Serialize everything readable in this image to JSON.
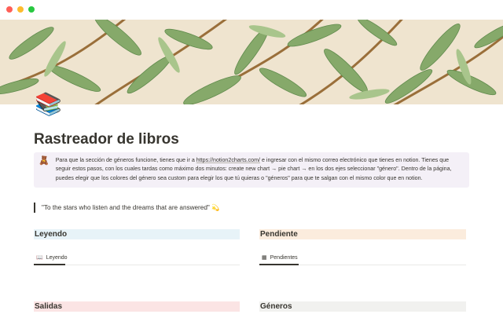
{
  "window": {
    "controls": [
      "close",
      "minimize",
      "maximize"
    ]
  },
  "cover": {
    "description_icon": "leaf-pattern-cover"
  },
  "page": {
    "icon": "📚",
    "title": "Rastreador de libros"
  },
  "callout": {
    "icon": "🧸",
    "text_before_link": "Para que la sección de géneros funcione, tienes que ir a ",
    "link": "https://notion2charts.com/",
    "text_after_link": " e ingresar con el mismo correo electrónico que tienes en notion. Tienes que seguir estos pasos, con los cuales tardas como máximo dos minutos: create new chart → pie chart → en los dos ejes seleccionar \"género\". Dentro de la página, puedes elegir que los colores del género sea custom para elegir los que tú quieras o \"géneros\" para que te salgan con el mismo color que en notion."
  },
  "quote": {
    "text": "\"To the stars who listen and the dreams that are answered\" 💫"
  },
  "sections": {
    "leyenda": {
      "heading": "Leyendo",
      "tab_label": "Leyendo",
      "tab_icon": "📖"
    },
    "pendiente": {
      "heading": "Pendiente",
      "tab_label": "Pendientes",
      "tab_icon": "▦"
    },
    "salidas": {
      "heading": "Salidas"
    },
    "generos": {
      "heading": "Géneros"
    }
  },
  "colors": {
    "leyenda_bg": "#e7f3f8",
    "pendiente_bg": "#fbecdd",
    "salidas_bg": "#fbe4e4",
    "generos_bg": "#f1f1ef",
    "callout_bg": "#f4f0f7"
  }
}
